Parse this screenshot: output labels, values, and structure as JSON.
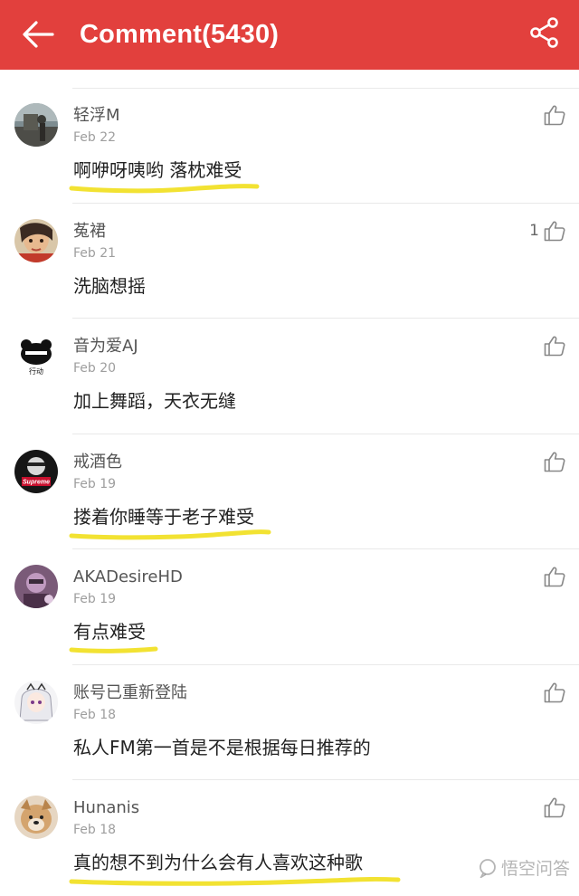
{
  "header": {
    "title": "Comment(5430)",
    "back_icon": "arrow-left-icon",
    "share_icon": "share-icon",
    "background": "#e2403d"
  },
  "comments": [
    {
      "user": "轻浮M",
      "date": "Feb 22",
      "text": "啊咿呀咦哟 落枕难受",
      "likes": "",
      "highlighted": true
    },
    {
      "user": "菟裙",
      "date": "Feb 21",
      "text": "洗脑想摇",
      "likes": "1",
      "highlighted": false
    },
    {
      "user": "音为爱AJ",
      "date": "Feb 20",
      "text": "加上舞蹈，天衣无缝",
      "likes": "",
      "highlighted": false
    },
    {
      "user": "戒酒色",
      "date": "Feb 19",
      "text": "搂着你睡等于老子难受",
      "likes": "",
      "highlighted": true
    },
    {
      "user": "AKADesireHD",
      "date": "Feb 19",
      "text": "有点难受",
      "likes": "",
      "highlighted": true
    },
    {
      "user": "账号已重新登陆",
      "date": "Feb 18",
      "text": "私人FM第一首是不是根据每日推荐的",
      "likes": "",
      "highlighted": false
    },
    {
      "user": "Hunanis",
      "date": "Feb 18",
      "text": "真的想不到为什么会有人喜欢这种歌",
      "likes": "",
      "highlighted": true
    }
  ],
  "avatar_labels": {
    "supreme": "Supreme",
    "xingdong": "行动"
  },
  "watermark": {
    "text": "悟空问答"
  },
  "colors": {
    "highlight": "#f2e232",
    "text": "#222222",
    "muted": "#9e9e9e"
  }
}
